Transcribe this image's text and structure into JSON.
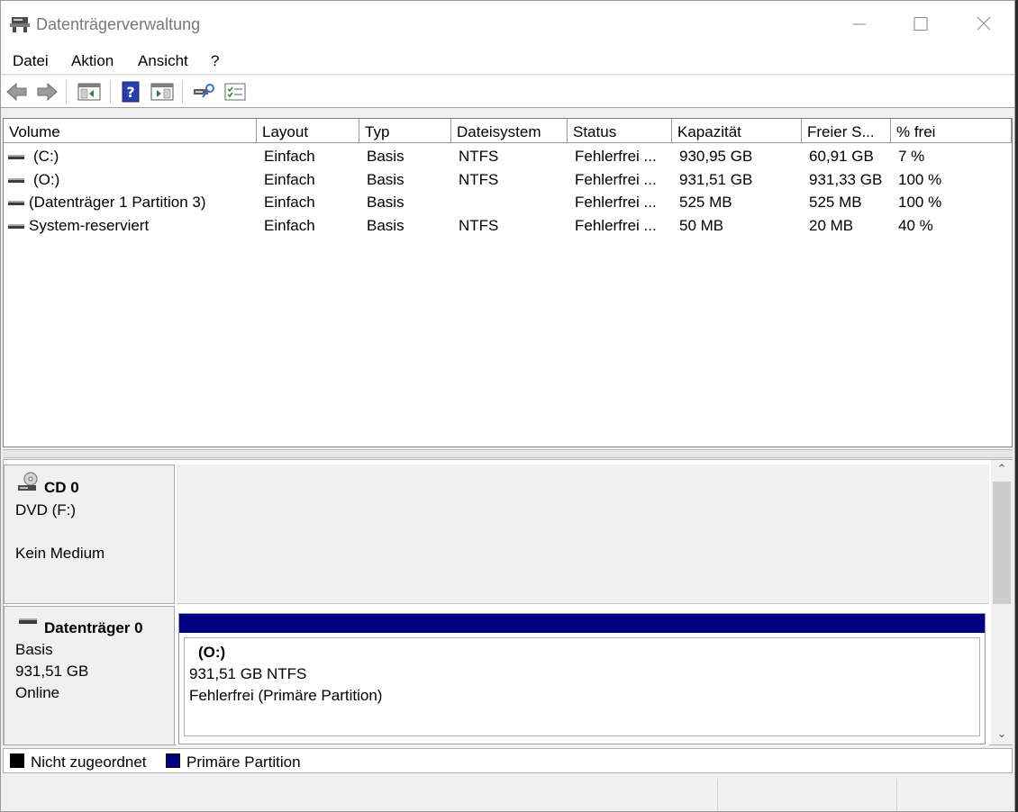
{
  "window": {
    "title": "Datenträgerverwaltung"
  },
  "menu": [
    "Datei",
    "Aktion",
    "Ansicht",
    "?"
  ],
  "toolbar": [
    "back-icon",
    "forward-icon",
    "console-tree-icon",
    "help-icon",
    "show-hide-action-pane-icon",
    "rescan-disks-icon",
    "properties-list-icon"
  ],
  "volume_table": {
    "columns": [
      "Volume",
      "Layout",
      "Typ",
      "Dateisystem",
      "Status",
      "Kapazität",
      "Freier S...",
      "% frei"
    ],
    "rows": [
      {
        "volume": "(C:)",
        "layout": "Einfach",
        "typ": "Basis",
        "dateisystem": "NTFS",
        "status": "Fehlerfrei ...",
        "kapazitaet": "930,95 GB",
        "frei": "60,91 GB",
        "prozent": "7 %"
      },
      {
        "volume": "(O:)",
        "layout": "Einfach",
        "typ": "Basis",
        "dateisystem": "NTFS",
        "status": "Fehlerfrei ...",
        "kapazitaet": "931,51 GB",
        "frei": "931,33 GB",
        "prozent": "100 %"
      },
      {
        "volume": "(Datenträger 1 Partition 3)",
        "layout": "Einfach",
        "typ": "Basis",
        "dateisystem": "",
        "status": "Fehlerfrei ...",
        "kapazitaet": "525 MB",
        "frei": "525 MB",
        "prozent": "100 %"
      },
      {
        "volume": "System-reserviert",
        "layout": "Einfach",
        "typ": "Basis",
        "dateisystem": "NTFS",
        "status": "Fehlerfrei ...",
        "kapazitaet": "50 MB",
        "frei": "20 MB",
        "prozent": "40 %"
      }
    ]
  },
  "disks": {
    "cd": {
      "name": "CD 0",
      "line1": "DVD (F:)",
      "line2": "Kein Medium"
    },
    "disk0": {
      "name": "Datenträger 0",
      "type": "Basis",
      "size": "931,51 GB",
      "state": "Online",
      "partition": {
        "name": "(O:)",
        "size_fs": "931,51 GB NTFS",
        "status": "Fehlerfrei (Primäre Partition)",
        "color": "#000080"
      }
    }
  },
  "legend": [
    {
      "label": "Nicht zugeordnet",
      "color": "#000000"
    },
    {
      "label": "Primäre Partition",
      "color": "#000080"
    }
  ]
}
